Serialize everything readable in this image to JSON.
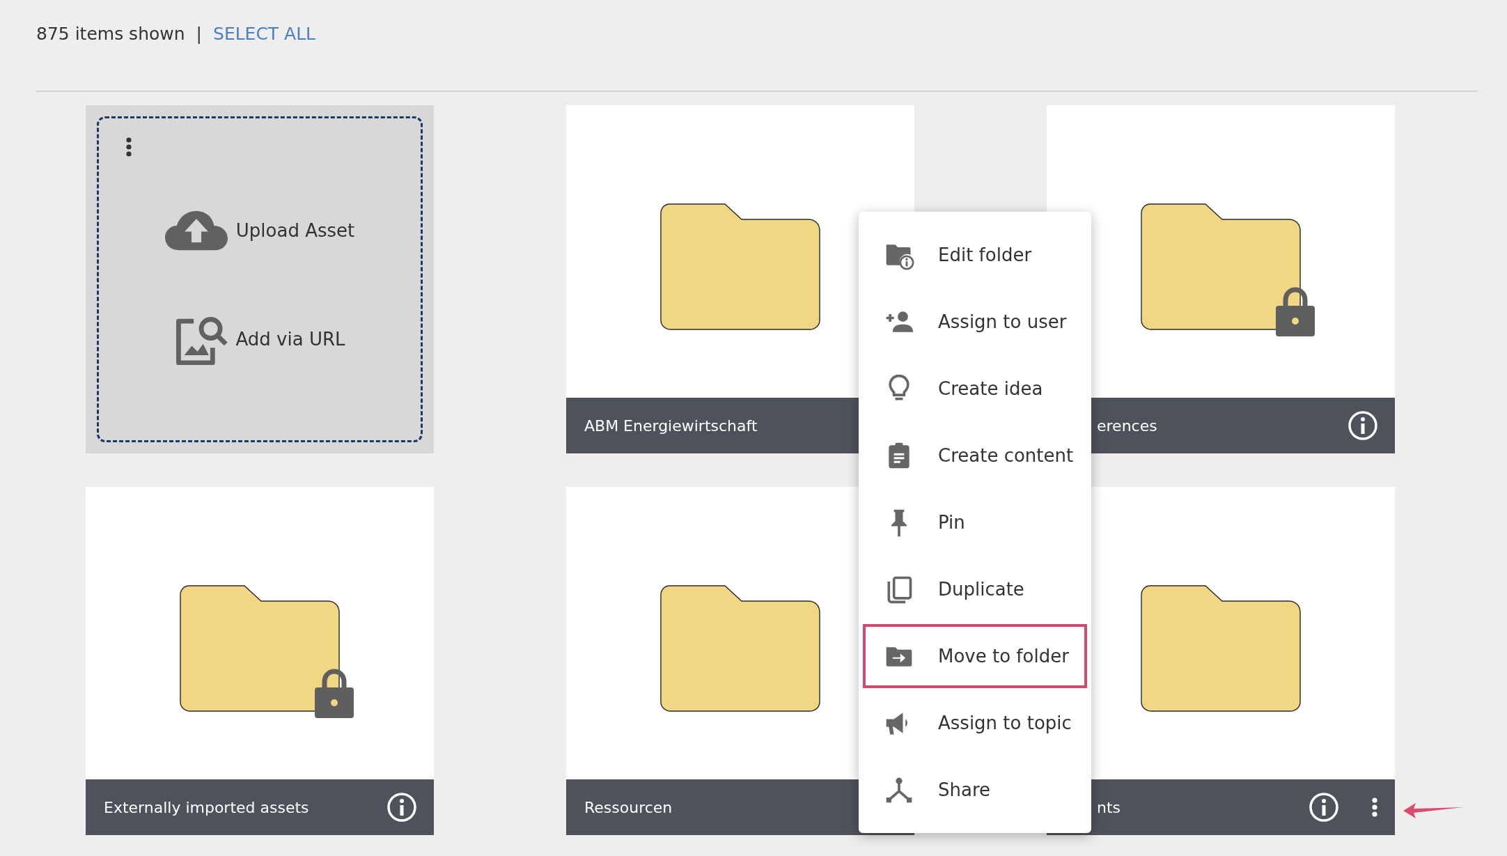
{
  "header": {
    "count": "875 items shown",
    "separator": "|",
    "select_all": "SELECT ALL"
  },
  "upload_card": {
    "actions": [
      {
        "label": "Upload Asset"
      },
      {
        "label": "Add via URL"
      }
    ]
  },
  "cards": [
    {
      "kind": "upload"
    },
    {
      "kind": "folder",
      "label": "ABM Energiewirtschaft",
      "locked": false,
      "covered": false,
      "hovered": false
    },
    {
      "kind": "folder",
      "label": "erences",
      "locked": true,
      "covered": true,
      "hovered": false
    },
    {
      "kind": "folder",
      "label": "Externally imported assets",
      "locked": true,
      "covered": false,
      "hovered": false
    },
    {
      "kind": "folder",
      "label": "Ressourcen",
      "locked": false,
      "covered": false,
      "hovered": false
    },
    {
      "kind": "folder",
      "label": "nts",
      "locked": false,
      "covered": true,
      "hovered": true
    }
  ],
  "context_menu": {
    "items": [
      {
        "label": "Edit folder",
        "selected": false
      },
      {
        "label": "Assign to user",
        "selected": false
      },
      {
        "label": "Create idea",
        "selected": false
      },
      {
        "label": "Create content",
        "selected": false
      },
      {
        "label": "Pin",
        "selected": false
      },
      {
        "label": "Duplicate",
        "selected": false
      },
      {
        "label": "Move to folder",
        "selected": true
      },
      {
        "label": "Assign to topic",
        "selected": false
      },
      {
        "label": "Share",
        "selected": false
      }
    ]
  }
}
